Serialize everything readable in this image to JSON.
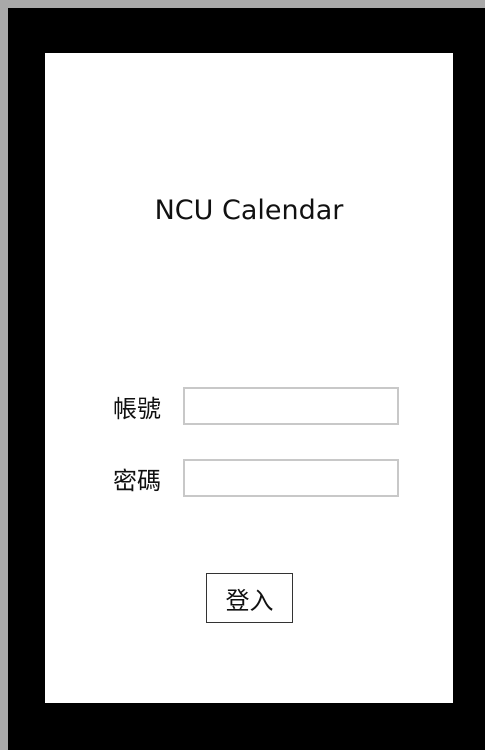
{
  "app": {
    "title": "NCU Calendar"
  },
  "login_form": {
    "account_label": "帳號",
    "account_value": "",
    "password_label": "密碼",
    "password_value": "",
    "submit_label": "登入"
  }
}
